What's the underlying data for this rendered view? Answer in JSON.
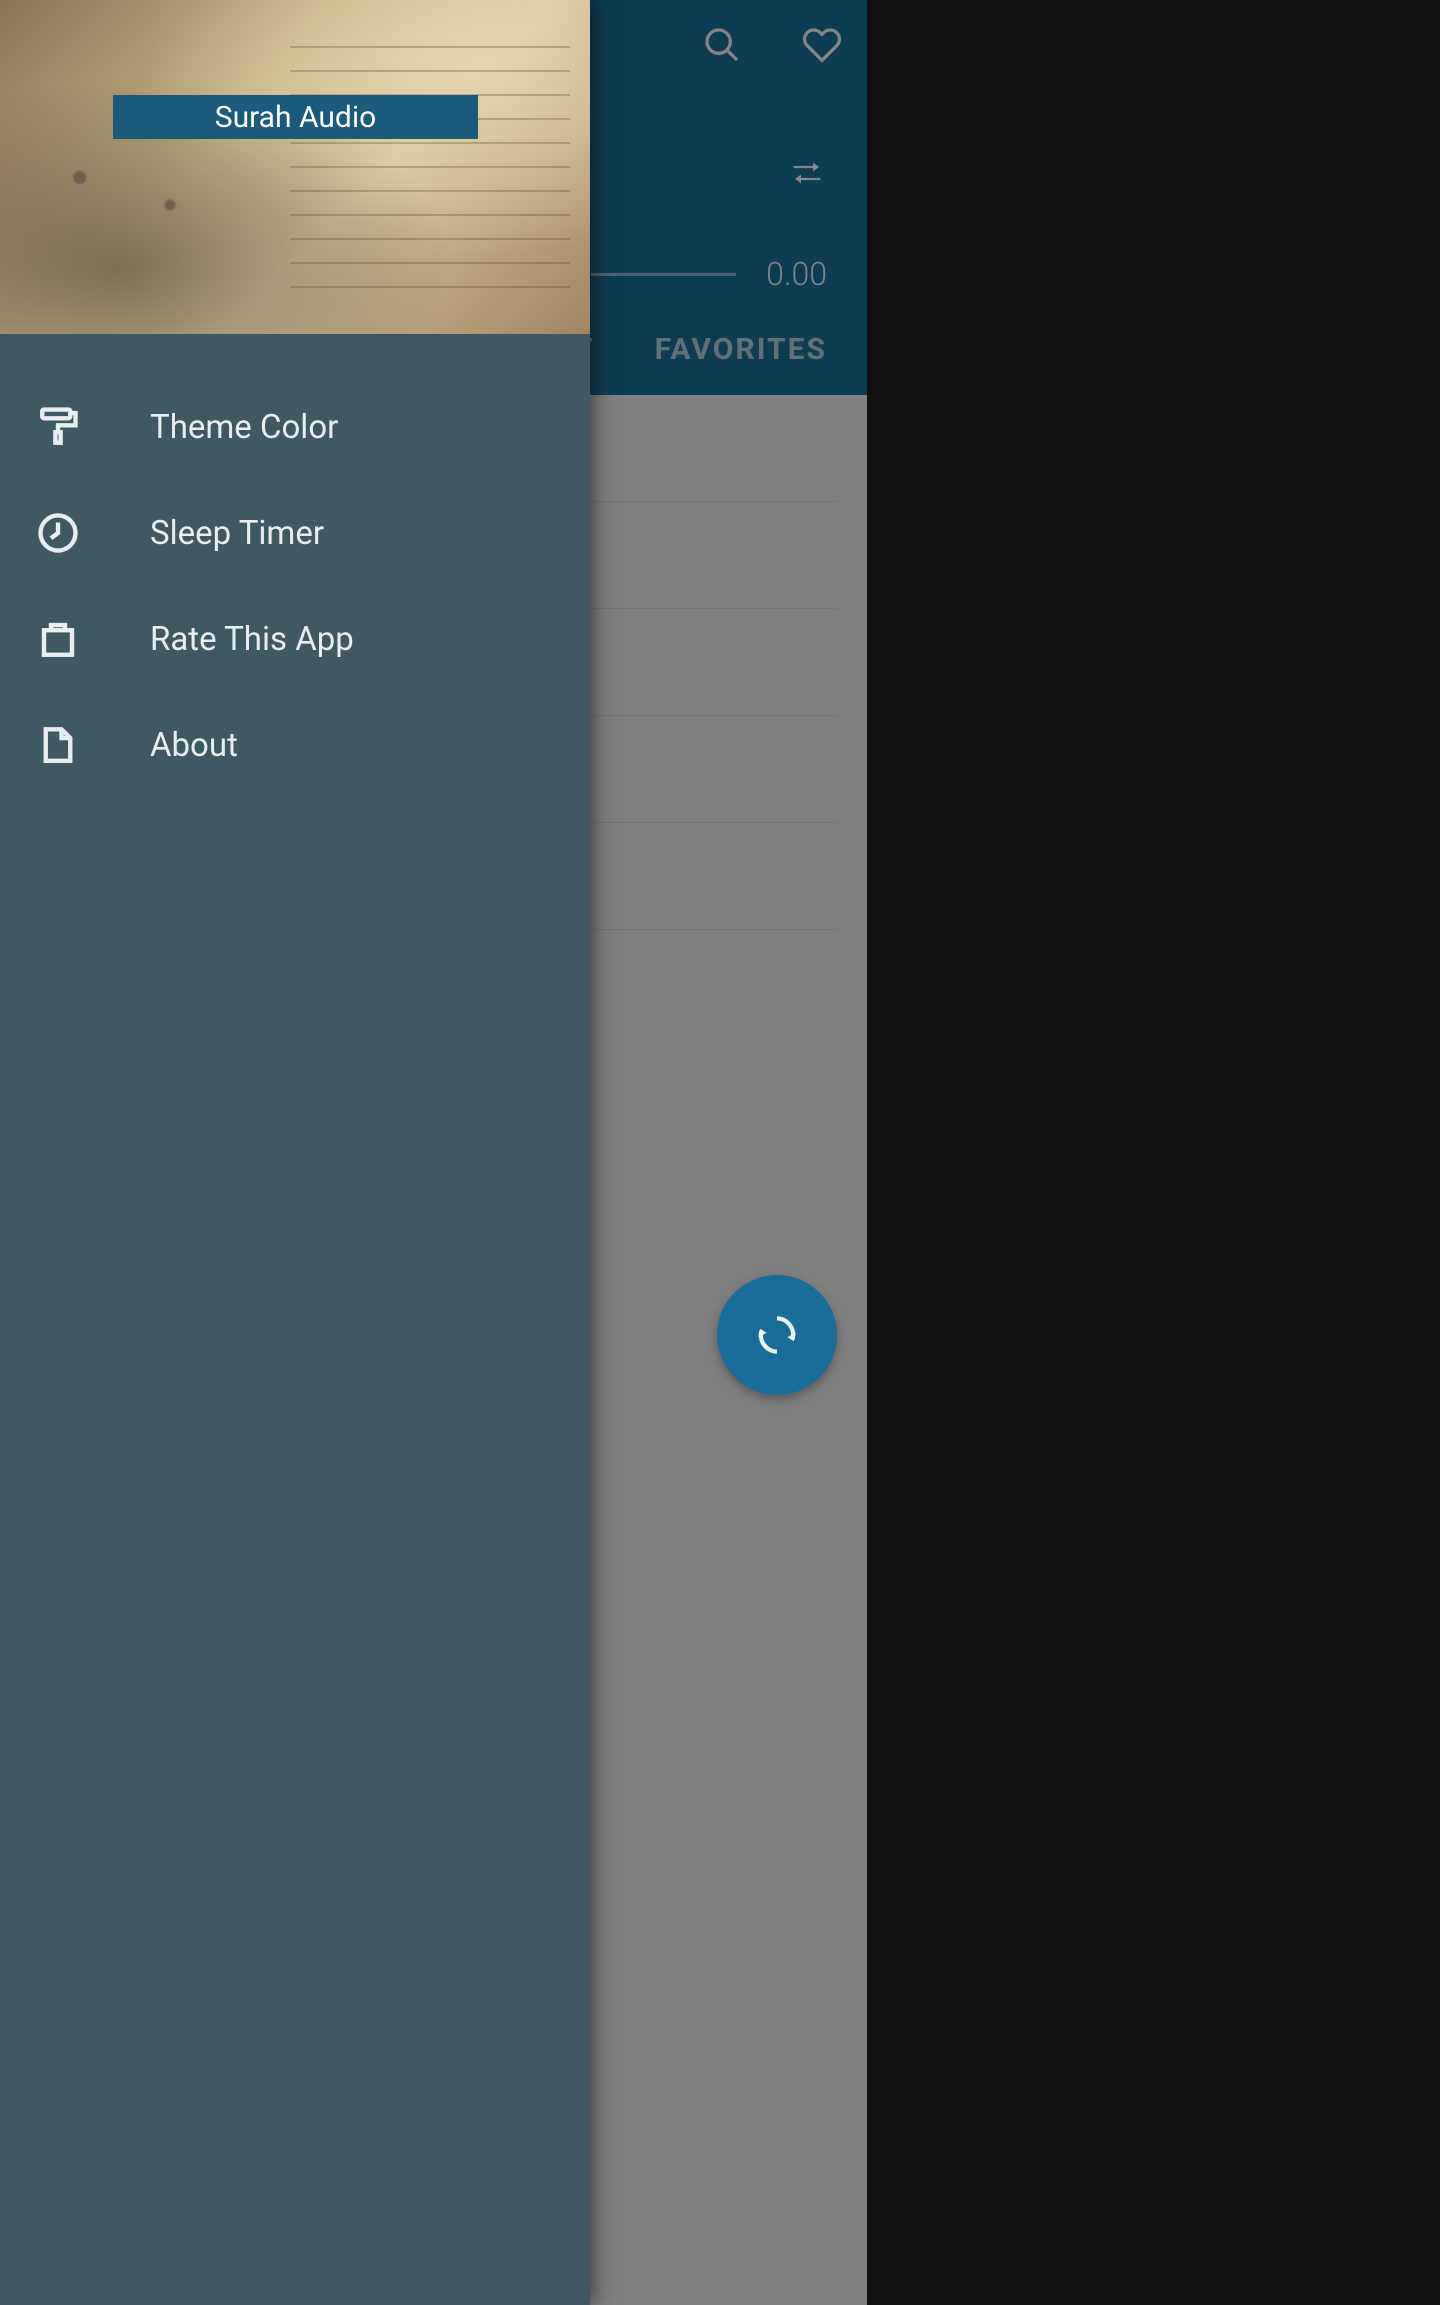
{
  "drawer": {
    "title": "Surah Audio",
    "items": [
      {
        "icon": "paint-roller-icon",
        "label": "Theme Color"
      },
      {
        "icon": "clock-icon",
        "label": "Sleep Timer"
      },
      {
        "icon": "shopping-bag-icon",
        "label": "Rate This App"
      },
      {
        "icon": "document-icon",
        "label": "About"
      }
    ]
  },
  "player": {
    "time": "0.00"
  },
  "tabs": {
    "partial": "ST",
    "favorites": "FAVORITES"
  }
}
